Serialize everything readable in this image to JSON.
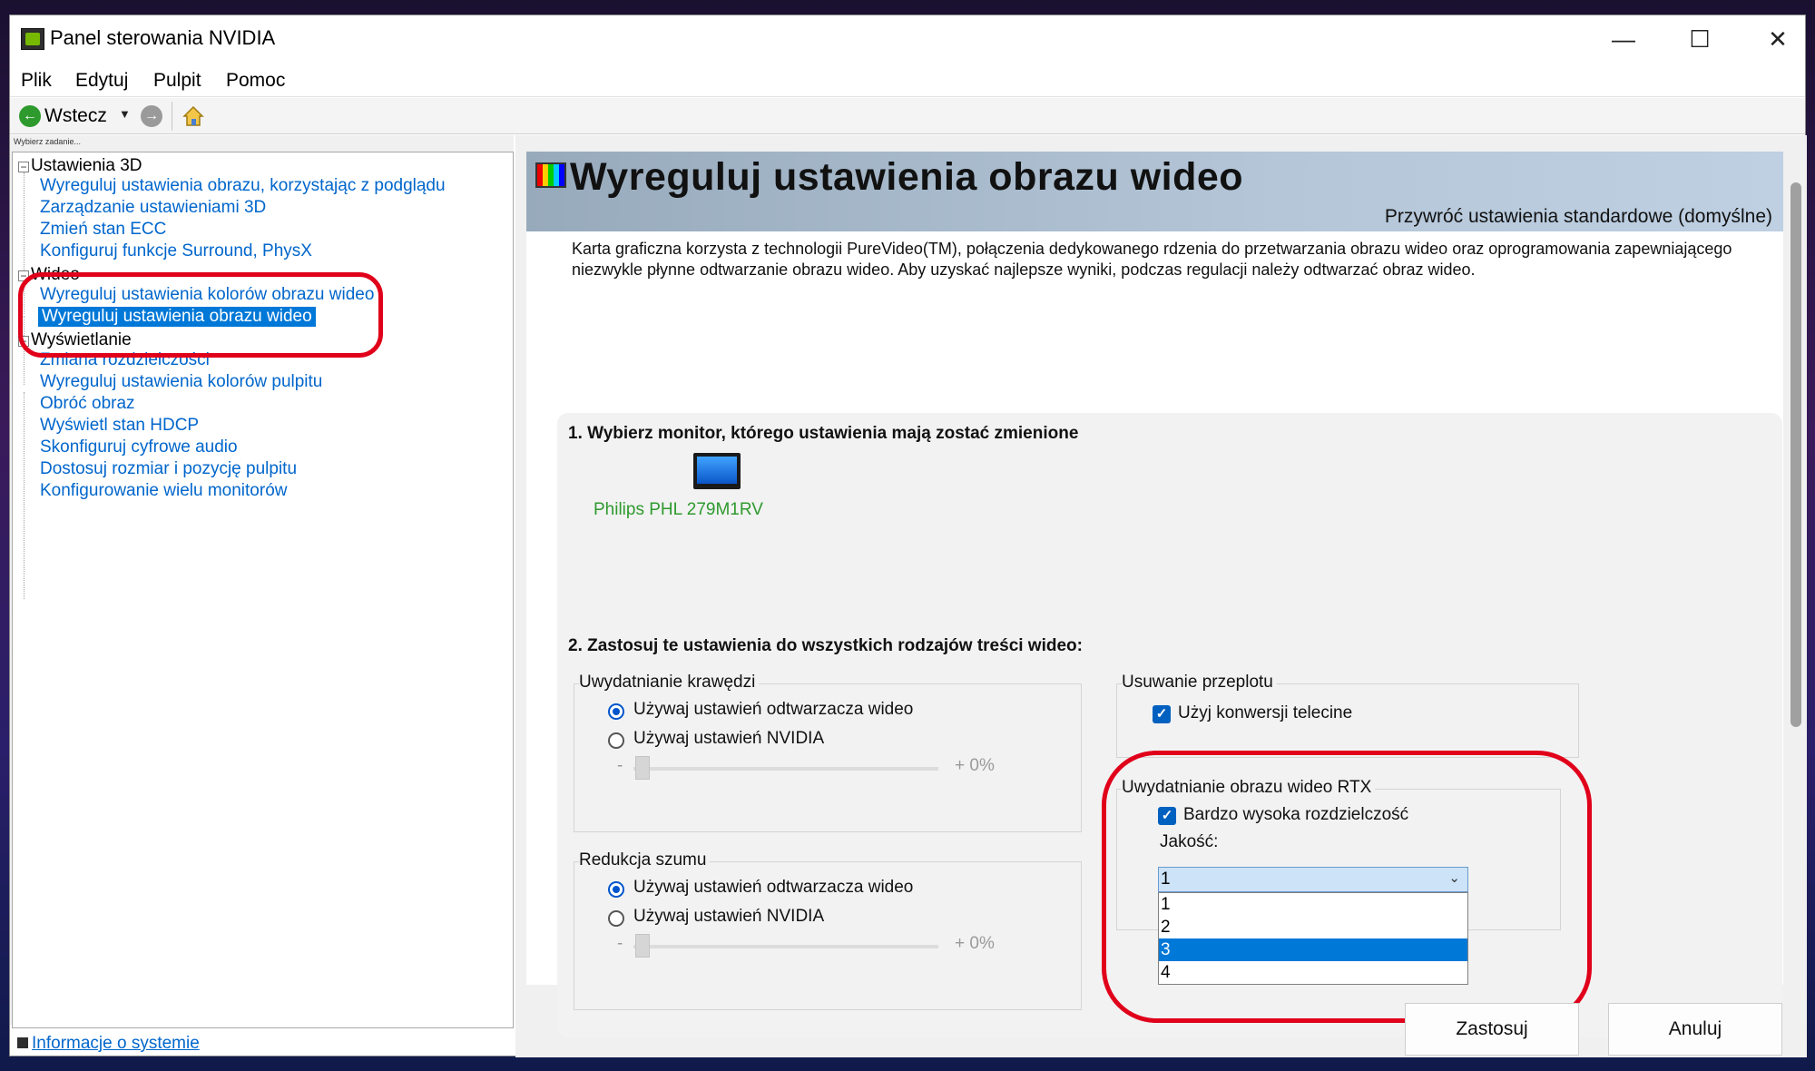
{
  "window": {
    "title": "Panel sterowania NVIDIA",
    "controls": {
      "minimize": "—",
      "maximize": "☐",
      "close": "✕"
    }
  },
  "menu": [
    "Plik",
    "Edytuj",
    "Pulpit",
    "Pomoc"
  ],
  "toolbar": {
    "back_label": "Wstecz",
    "dropdown": "▼"
  },
  "sidebar": {
    "task_hint": "Wybierz zadanie...",
    "categories": [
      {
        "label": "Ustawienia 3D",
        "items": [
          "Wyreguluj ustawienia obrazu, korzystając z podglądu",
          "Zarządzanie ustawieniami 3D",
          "Zmień stan ECC",
          "Konfiguruj funkcje Surround, PhysX"
        ]
      },
      {
        "label": "Wideo",
        "items": [
          "Wyreguluj ustawienia kolorów obrazu wideo",
          "Wyreguluj ustawienia obrazu wideo"
        ]
      },
      {
        "label": "Wyświetlanie",
        "items": [
          "Zmiana rozdzielczości",
          "Wyreguluj ustawienia kolorów pulpitu",
          "Obróć obraz",
          "Wyświetl stan HDCP",
          "Skonfiguruj cyfrowe audio",
          "Dostosuj rozmiar i pozycję pulpitu",
          "Konfigurowanie wielu monitorów"
        ]
      }
    ],
    "selected": "Wyreguluj ustawienia obrazu wideo",
    "footer_link": "Informacje o systemie"
  },
  "main": {
    "title": "Wyreguluj ustawienia obrazu wideo",
    "restore_link": "Przywróć ustawienia standardowe (domyślne)",
    "description": "Karta graficzna korzysta z technologii PureVideo(TM), połączenia dedykowanego rdzenia do przetwarzania obrazu wideo oraz oprogramowania zapewniającego niezwykle płynne odtwarzanie obrazu wideo. Aby uzyskać najlepsze wyniki, podczas regulacji należy odtwarzać obraz wideo.",
    "step1": {
      "title": "1. Wybierz monitor, którego ustawienia mają zostać zmienione",
      "monitor_name": "Philips PHL 279M1RV"
    },
    "step2": {
      "title": "2. Zastosuj te ustawienia do wszystkich rodzajów treści wideo:",
      "edge": {
        "label": "Uwydatnianie krawędzi",
        "options": [
          "Używaj ustawień odtwarzacza wideo",
          "Używaj ustawień NVIDIA"
        ],
        "selected": 0,
        "minus": "-",
        "value": "+ 0%",
        "level": 0
      },
      "noise": {
        "label": "Redukcja szumu",
        "options": [
          "Używaj ustawień odtwarzacza wideo",
          "Używaj ustawień NVIDIA"
        ],
        "selected": 0,
        "minus": "-",
        "value": "+ 0%",
        "level": 0
      },
      "deinterlace": {
        "label": "Usuwanie przeplotu",
        "checkbox": "Użyj konwersji telecine",
        "checked": true
      },
      "rtx": {
        "label": "Uwydatnianie obrazu wideo RTX",
        "checkbox": "Bardzo wysoka rozdzielczość",
        "checked": true,
        "quality_label": "Jakość:",
        "quality_value": "1",
        "dropdown_options": [
          "1",
          "2",
          "3",
          "4"
        ],
        "dropdown_highlighted": "3"
      }
    }
  },
  "buttons": {
    "apply": "Zastosuj",
    "cancel": "Anuluj"
  },
  "colors": {
    "link": "#0066cc",
    "selection": "#0078d7",
    "highlight_ring": "#e0001a",
    "nvidia_green": "#76b900",
    "monitor_label": "#2e9a2e"
  }
}
